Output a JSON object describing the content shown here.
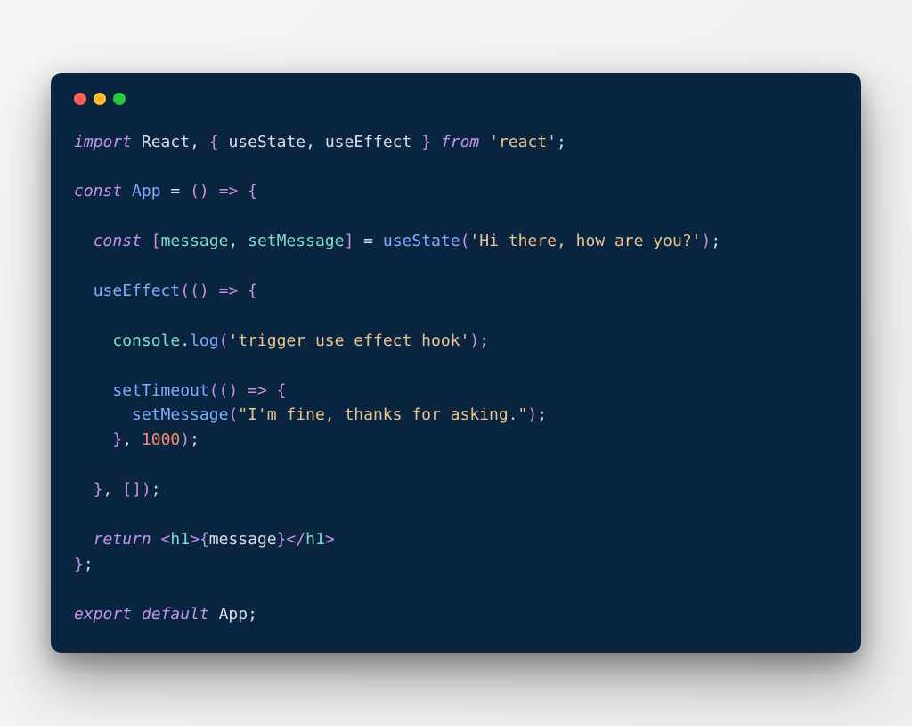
{
  "window": {
    "dots": [
      "red",
      "yellow",
      "green"
    ]
  },
  "code": {
    "kw_import": "import",
    "react": "React",
    "useState": "useState",
    "useEffect": "useEffect",
    "kw_from": "from",
    "react_pkg": "'react'",
    "kw_const": "const",
    "app_name": "App",
    "arrow": "=>",
    "message_var": "message",
    "setMessage_var": "setMessage",
    "useState_call": "useState",
    "initial_msg": "'Hi there, how are you?'",
    "useEffect_call": "useEffect",
    "console_obj": "console",
    "log_method": "log",
    "log_arg": "'trigger use effect hook'",
    "setTimeout_call": "setTimeout",
    "setMessage_call": "setMessage",
    "fine_msg": "\"I'm fine, thanks for asking.\"",
    "timeout_delay": "1000",
    "kw_return": "return",
    "h1_open": "h1",
    "h1_close": "h1",
    "kw_export": "export",
    "kw_default": "default"
  }
}
